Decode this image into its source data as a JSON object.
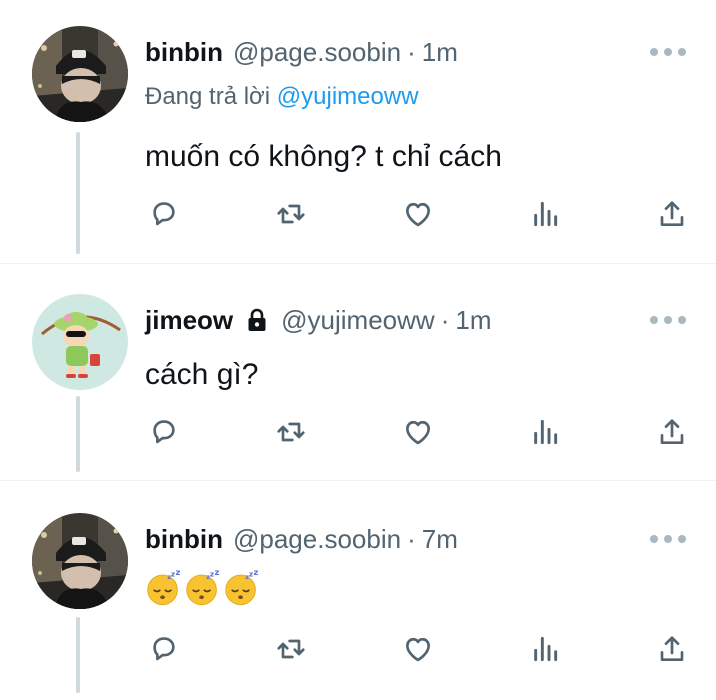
{
  "tweets": [
    {
      "name": "binbin",
      "handle": "@page.soobin",
      "dot": "·",
      "time": "1m",
      "reply_prefix": "Đang trả lời ",
      "reply_mention": "@yujimeoww",
      "text": "muốn có không? t chỉ cách",
      "avatar_icon": "profile-photo-beanie"
    },
    {
      "name": "jimeow",
      "handle": "@yujimeoww",
      "dot": "·",
      "time": "1m",
      "protected_icon": "lock-icon",
      "text": "cách gì?",
      "avatar_icon": "cartoon-character-sunhat"
    },
    {
      "name": "binbin",
      "handle": "@page.soobin",
      "dot": "·",
      "time": "7m",
      "emojis": [
        "sleeping-face",
        "sleeping-face",
        "sleeping-face"
      ],
      "avatar_icon": "profile-photo-beanie"
    }
  ],
  "action_icons": [
    "reply-icon",
    "retweet-icon",
    "like-icon",
    "views-icon",
    "share-icon"
  ],
  "colors": {
    "text": "#0f1419",
    "secondary": "#536471",
    "link": "#1d9bf0",
    "thread_line": "#cfd9de",
    "divider": "#eff3f4"
  }
}
